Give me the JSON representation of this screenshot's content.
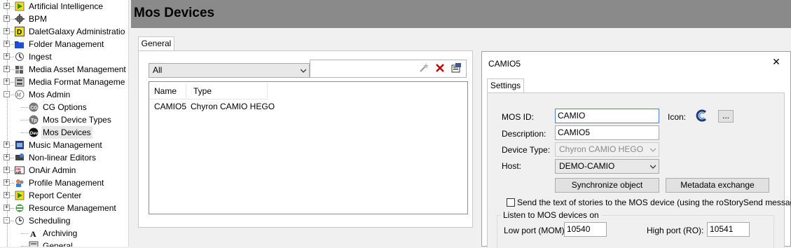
{
  "tree": {
    "items": [
      {
        "label": "Artificial Intelligence",
        "expander": "+",
        "icon": "play-icon"
      },
      {
        "label": "BPM",
        "expander": "+",
        "icon": "gear-icon"
      },
      {
        "label": "DaletGalaxy Administratio",
        "expander": "+",
        "icon": "dalet-d-icon"
      },
      {
        "label": "Folder Management",
        "expander": "+",
        "icon": "folder-icon"
      },
      {
        "label": "Ingest",
        "expander": "+",
        "icon": "ingest-icon"
      },
      {
        "label": "Media Asset Management",
        "expander": "+",
        "icon": "media-asset-icon"
      },
      {
        "label": "Media Format Manageme",
        "expander": "+",
        "icon": "media-format-icon"
      },
      {
        "label": "Mos Admin",
        "expander": "-",
        "icon": "mos-icon"
      },
      {
        "label": "CG Options",
        "icon": "cg-icon",
        "child": true
      },
      {
        "label": "Mos Device Types",
        "icon": "device-types-icon",
        "child": true
      },
      {
        "label": "Mos Devices",
        "icon": "dev-icon",
        "child": true,
        "selected": true
      },
      {
        "label": "Music Management",
        "expander": "+",
        "icon": "music-icon"
      },
      {
        "label": "Non-linear Editors",
        "expander": "+",
        "icon": "editors-icon"
      },
      {
        "label": "OnAir Admin",
        "expander": "+",
        "icon": "onair-icon"
      },
      {
        "label": "Profile Management",
        "expander": "+",
        "icon": "profile-icon"
      },
      {
        "label": "Report Center",
        "expander": "+",
        "icon": "report-icon"
      },
      {
        "label": "Resource Management",
        "expander": "+",
        "icon": "resource-icon"
      },
      {
        "label": "Scheduling",
        "expander": "-",
        "icon": "scheduling-icon"
      },
      {
        "label": "Archiving",
        "icon": "archiving-a-icon",
        "child": true
      },
      {
        "label": "General",
        "icon": "general-icon",
        "child": true
      }
    ]
  },
  "header": {
    "title": "Mos Devices"
  },
  "general_tab": {
    "label": "General"
  },
  "filter": {
    "value": "All"
  },
  "list": {
    "columns": [
      "Name",
      "Type"
    ],
    "rows": [
      {
        "name": "CAMIO5",
        "type": "Chyron CAMIO HEGO"
      }
    ]
  },
  "dialog": {
    "title": "CAMIO5",
    "close_glyph": "✕",
    "settings_tab": "Settings",
    "mos_id_label": "MOS ID:",
    "mos_id_value": "CAMIO",
    "description_label": "Description:",
    "description_value": "CAMIO5",
    "device_type_label": "Device Type:",
    "device_type_value": "Chyron CAMIO HEGO",
    "host_label": "Host:",
    "host_value": "DEMO-CAMIO",
    "icon_label": "Icon:",
    "icon_browse": "...",
    "sync_button": "Synchronize object",
    "metadata_button": "Metadata exchange",
    "send_text_label": "Send the text of stories to the MOS device (using the roStorySend message)",
    "send_text_checked": false,
    "listen_group": "Listen to MOS devices on",
    "low_port_label": "Low port (MOM):",
    "low_port_value": "10540",
    "high_port_label": "High port (RO):",
    "high_port_value": "10541"
  },
  "colors": {
    "title_bar": "#8a8a8a",
    "folder_blue": "#1a3fbf",
    "dalet_yellow": "#f5e000",
    "selection": "#e8e8e8"
  }
}
